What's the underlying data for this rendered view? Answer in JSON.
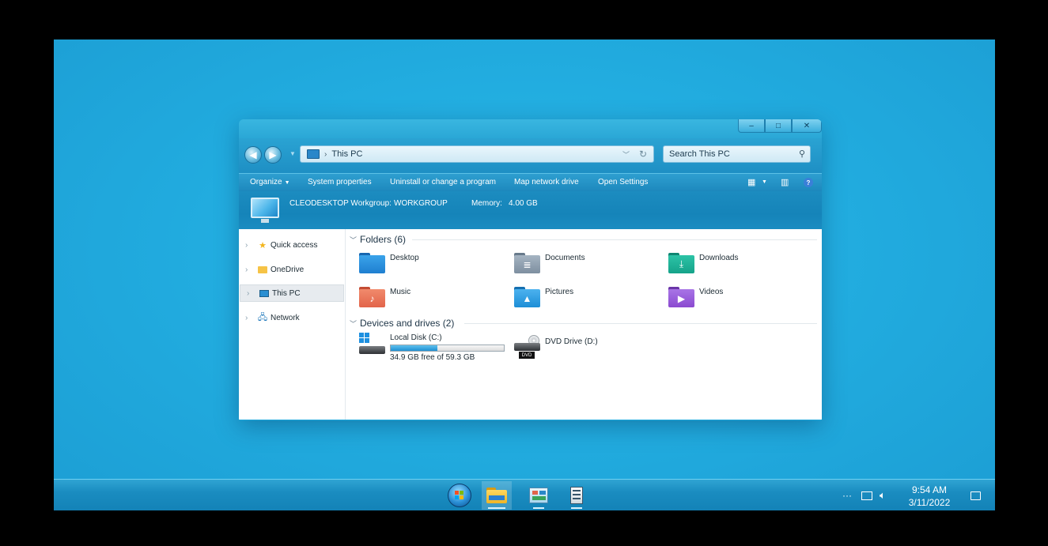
{
  "window": {
    "title_buttons": {
      "minimize": "–",
      "maximize": "□",
      "close": "✕"
    },
    "address": {
      "path": "This PC",
      "separator": "›"
    },
    "search": {
      "placeholder": "Search This PC"
    },
    "commands": [
      "Organize",
      "System properties",
      "Uninstall or change a program",
      "Map network drive",
      "Open Settings"
    ],
    "details": {
      "computer_line": "CLEODESKTOP Workgroup:",
      "workgroup": "WORKGROUP",
      "memory_label": "Memory:",
      "memory_value": "4.00 GB"
    },
    "sidebar": {
      "items": [
        {
          "label": "Quick access",
          "icon": "star-icon"
        },
        {
          "label": "OneDrive",
          "icon": "folder-icon"
        },
        {
          "label": "This PC",
          "icon": "monitor-icon",
          "selected": true
        },
        {
          "label": "Network",
          "icon": "network-icon"
        }
      ]
    },
    "folders_group": {
      "header": "Folders (6)",
      "items": [
        {
          "label": "Desktop",
          "color": "#1f7fd0"
        },
        {
          "label": "Documents",
          "color": "#7e8fa0"
        },
        {
          "label": "Downloads",
          "color": "#16a38a"
        },
        {
          "label": "Music",
          "color": "#e2644a"
        },
        {
          "label": "Pictures",
          "color": "#1d8ed6"
        },
        {
          "label": "Videos",
          "color": "#8b4ad0"
        }
      ]
    },
    "drives_group": {
      "header": "Devices and drives (2)",
      "local_disk": {
        "label": "Local Disk (C:)",
        "free_text": "34.9 GB free of 59.3 GB",
        "used_fraction": 0.41
      },
      "dvd": {
        "label": "DVD Drive (D:)",
        "badge": "DVD"
      }
    }
  },
  "taskbar": {
    "clock": {
      "time": "9:54 AM",
      "date": "3/11/2022"
    },
    "tray_more": "···"
  },
  "colors": {
    "desktop": "#22ade0",
    "accent": "#1d88bd"
  }
}
